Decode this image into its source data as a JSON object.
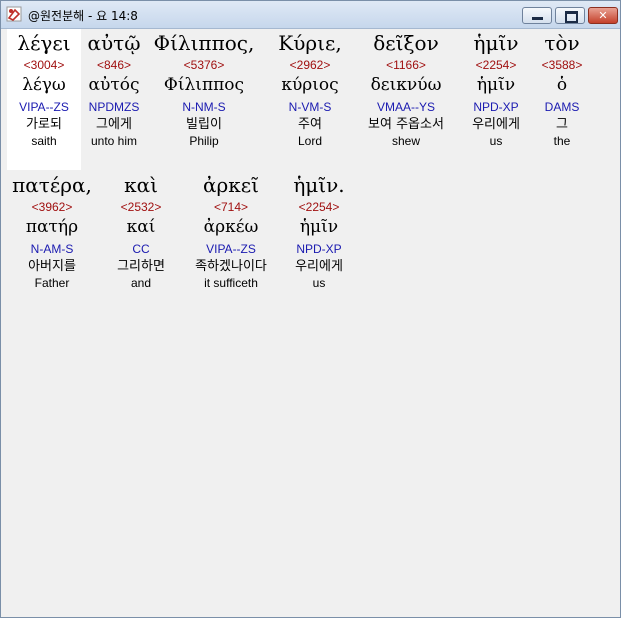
{
  "window": {
    "title": "@원전분해 - 요 14:8",
    "controls": {
      "minimize": "",
      "maximize": "",
      "close": "✕"
    }
  },
  "verse": {
    "words": [
      {
        "greek": "λέγει",
        "strong": "<3004>",
        "lemma": "λέγω",
        "morph": "VIPA--ZS",
        "korean": "가로되",
        "english": "saith"
      },
      {
        "greek": "αὐτῷ",
        "strong": "<846>",
        "lemma": "αὐτός",
        "morph": "NPDMZS",
        "korean": "그에게",
        "english": "unto him"
      },
      {
        "greek": "Φίλιππος,",
        "strong": "<5376>",
        "lemma": "Φίλιππος",
        "morph": "N-NM-S",
        "korean": "빌립이",
        "english": "Philip"
      },
      {
        "greek": "Κύριε,",
        "strong": "<2962>",
        "lemma": "κύριος",
        "morph": "N-VM-S",
        "korean": "주여",
        "english": "Lord"
      },
      {
        "greek": "δεῖξον",
        "strong": "<1166>",
        "lemma": "δεικνύω",
        "morph": "VMAA--YS",
        "korean": "보여 주옵소서",
        "english": "shew"
      },
      {
        "greek": "ἡμῖν",
        "strong": "<2254>",
        "lemma": "ἡμῖν",
        "morph": "NPD-XP",
        "korean": "우리에게",
        "english": "us"
      },
      {
        "greek": "τὸν",
        "strong": "<3588>",
        "lemma": "ὁ",
        "morph": "DAMS",
        "korean": "그",
        "english": "the"
      },
      {
        "greek": "πατέρα,",
        "strong": "<3962>",
        "lemma": "πατήρ",
        "morph": "N-AM-S",
        "korean": "아버지를",
        "english": "Father"
      },
      {
        "greek": "καὶ",
        "strong": "<2532>",
        "lemma": "καί",
        "morph": "CC",
        "korean": "그리하면",
        "english": "and"
      },
      {
        "greek": "ἀρκεῖ",
        "strong": "<714>",
        "lemma": "ἀρκέω",
        "morph": "VIPA--ZS",
        "korean": "족하겠나이다",
        "english": "it sufficeth"
      },
      {
        "greek": "ἡμῖν.",
        "strong": "<2254>",
        "lemma": "ἡμῖν",
        "morph": "NPD-XP",
        "korean": "우리에게",
        "english": "us"
      }
    ]
  }
}
